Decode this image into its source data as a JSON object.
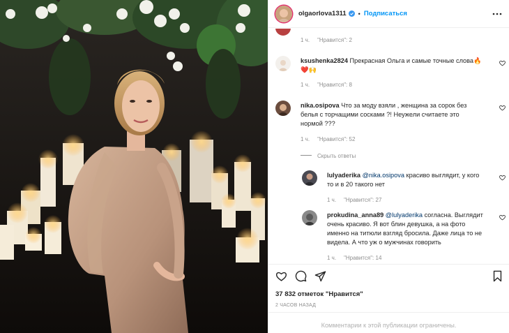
{
  "header": {
    "username": "olgaorlova1311",
    "follow_label": "Подписаться",
    "dot": "•"
  },
  "comments": [
    {
      "id": "c0",
      "time": "1 ч.",
      "likes": "\"Нравится\": 2"
    },
    {
      "id": "c1",
      "username": "ksushenka2824",
      "text": "Прекрасная Ольга и самые точные слова🔥❤️🙌",
      "time": "1 ч.",
      "likes": "\"Нравится\": 8"
    },
    {
      "id": "c2",
      "username": "nika.osipova",
      "text_lines": [
        "Что за моду взяли , женщина за сорок без",
        "белья с торчащими сосками ?! Неужели считаете это",
        "нормой ???"
      ],
      "time": "1 ч.",
      "likes": "\"Нравится\": 52"
    },
    {
      "id": "hide",
      "label": "Скрыть ответы"
    },
    {
      "id": "r1",
      "username": "lulyaderika",
      "mention": "@nika.osipova",
      "text_lines": [
        "красиво выглядит, у кого",
        "то и в 20 такого нет"
      ],
      "time": "1 ч.",
      "likes": "\"Нравится\": 27"
    },
    {
      "id": "r2",
      "username": "prokudina_anna89",
      "mention": "@lulyaderika",
      "text_lines": [
        "согласна. Выглядит",
        "очень красиво. Я вот блин девушка, а на фото",
        "именно на титюли взгляд бросила. Даже лица то не",
        "видела. А что уж о мужчинах говорить"
      ],
      "time": "1 ч.",
      "likes": "\"Нравится\": 14"
    }
  ],
  "post": {
    "like_count": "37 832 отметок \"Нравится\"",
    "time_ago": "2 ЧАСОВ НАЗАД",
    "comments_limited": "Комментарии к этой публикации ограничены."
  },
  "icons": {
    "verified": "verified-icon",
    "more": "more-icon",
    "like": "heart-icon",
    "comment": "comment-icon",
    "share": "share-icon",
    "save": "bookmark-icon"
  },
  "colors": {
    "accent": "#0095f6",
    "verified": "#3897f0",
    "mention": "#00376b",
    "muted": "#8e8e8e"
  }
}
